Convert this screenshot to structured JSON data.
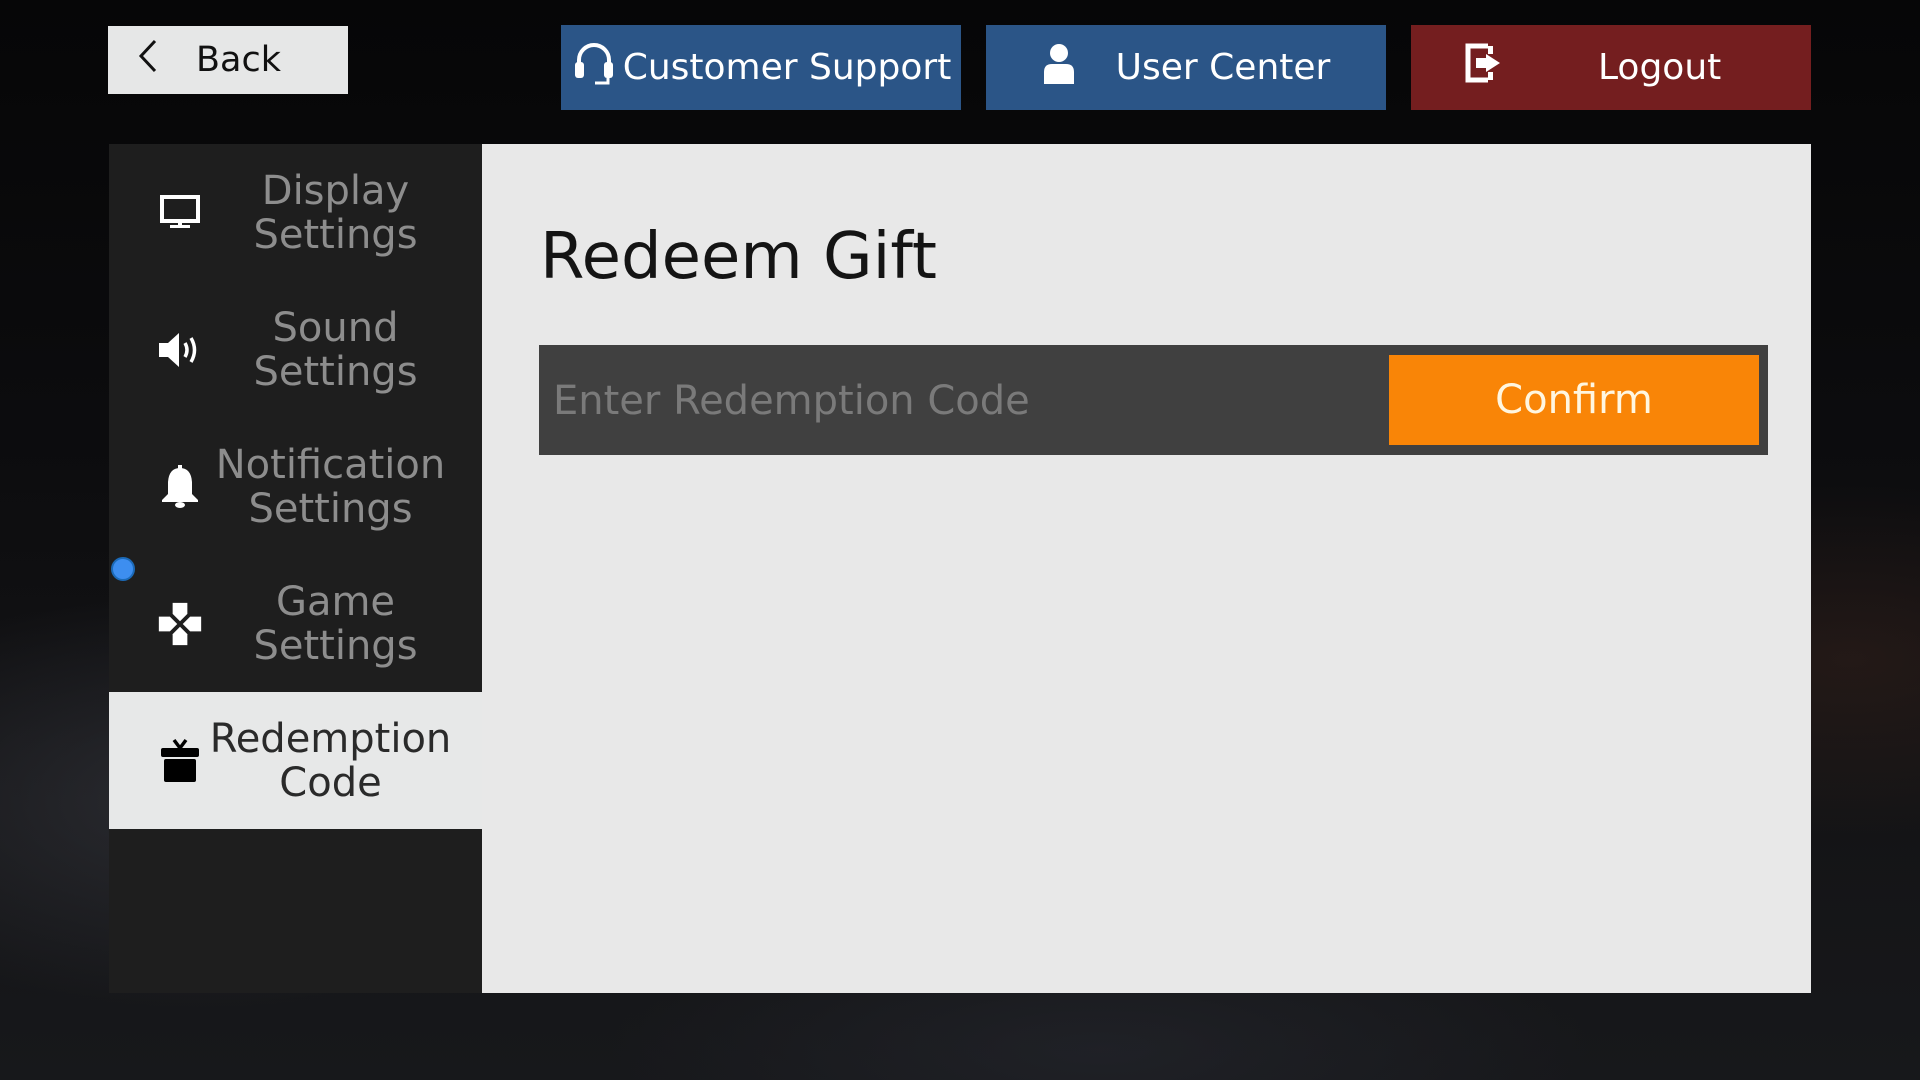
{
  "header": {
    "back_label": "Back",
    "customer_support_label": "Customer Support",
    "user_center_label": "User Center",
    "logout_label": "Logout",
    "icons": {
      "back": "chevron-left-icon",
      "customer_support": "headset-icon",
      "user_center": "user-icon",
      "logout": "logout-icon"
    }
  },
  "sidebar": {
    "items": [
      {
        "label_line1": "Display",
        "label_line2": "Settings",
        "icon": "monitor-icon",
        "selected": false
      },
      {
        "label_line1": "Sound",
        "label_line2": "Settings",
        "icon": "speaker-icon",
        "selected": false
      },
      {
        "label_line1": "Notification",
        "label_line2": "Settings",
        "icon": "bell-icon",
        "selected": false
      },
      {
        "label_line1": "Game",
        "label_line2": "Settings",
        "icon": "gamepad-icon",
        "selected": false
      },
      {
        "label_line1": "Redemption",
        "label_line2": "Code",
        "icon": "gift-icon",
        "selected": true
      }
    ]
  },
  "main": {
    "title": "Redeem Gift",
    "code_input": {
      "value": "",
      "placeholder": "Enter Redemption Code"
    },
    "confirm_label": "Confirm"
  },
  "colors": {
    "primary_blue": "#2b5587",
    "logout_red": "#741e1f",
    "confirm_orange": "#f98507",
    "sidebar_bg": "#1e1e1e",
    "panel_bg": "#e8e8e8",
    "input_bg": "#404040"
  }
}
